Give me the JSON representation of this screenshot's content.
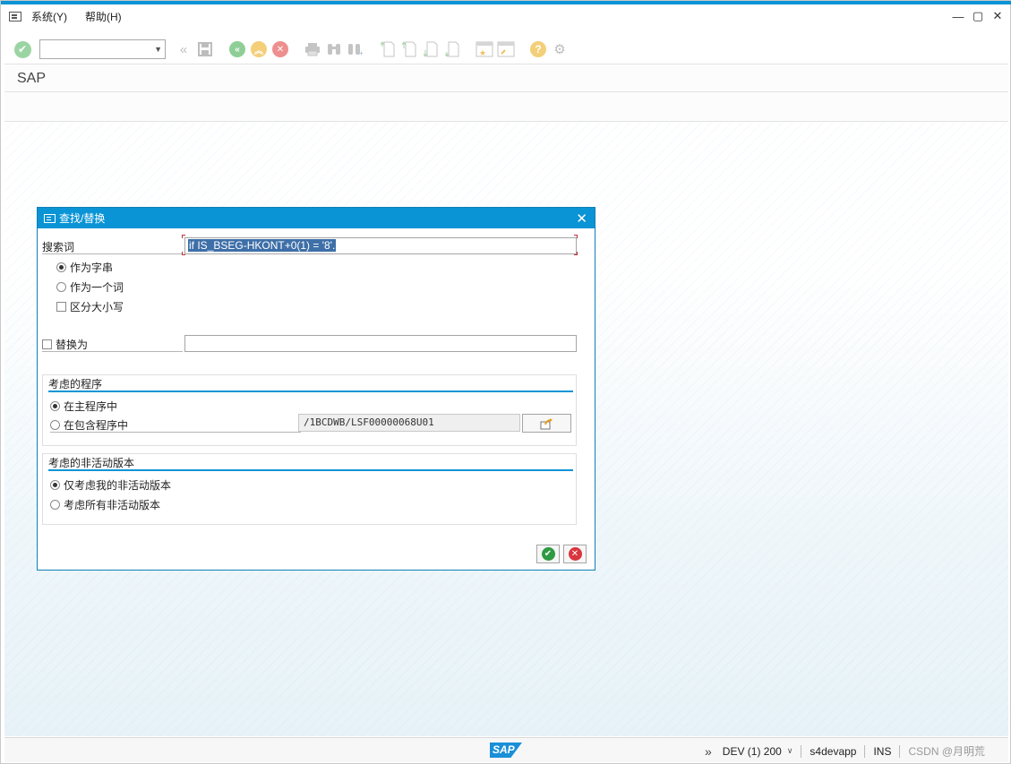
{
  "menu": {
    "items": [
      "系统(Y)",
      "帮助(H)"
    ]
  },
  "window_controls": [
    "—",
    "▢",
    "✕"
  ],
  "toolbar": {
    "command_value": ""
  },
  "screen": {
    "title": "SAP"
  },
  "dialog": {
    "title": "查找/替换",
    "search_label": "搜索词",
    "search_value": "if IS_BSEG-HKONT+0(1) = '8'.",
    "as_string_label": "作为字串",
    "as_word_label": "作为一个词",
    "case_label": "区分大小写",
    "replace_label": "替换为",
    "replace_value": "",
    "program_group": {
      "title": "考虑的程序",
      "main_label": "在主程序中",
      "include_label": "在包含程序中",
      "include_value": "/1BCDWB/LSF00000068U01"
    },
    "inactive_group": {
      "title": "考虑的非活动版本",
      "mine_label": "仅考虑我的非活动版本",
      "all_label": "考虑所有非活动版本"
    }
  },
  "statusbar": {
    "logo_text": "SAP",
    "system": "DEV (1) 200",
    "server": "s4devapp",
    "mode": "INS",
    "watermark": "CSDN @月明荒"
  },
  "colors": {
    "accent": "#0a94d6",
    "ok_green": "#2f9a43",
    "cancel_red": "#d9363e"
  }
}
